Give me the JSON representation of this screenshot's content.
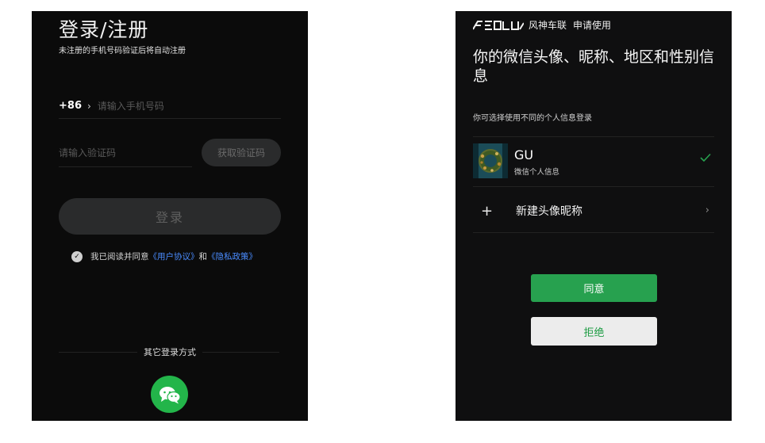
{
  "login": {
    "title": "登录/注册",
    "subtitle": "未注册的手机号码验证后将自动注册",
    "country_code": "+86",
    "chevron": "›",
    "phone_placeholder": "请输入手机号码",
    "code_placeholder": "请输入验证码",
    "get_code": "获取验证码",
    "login_button": "登录",
    "agreement": {
      "prefix": "我已阅读并同意",
      "user_agreement": "《用户协议》",
      "and": "和",
      "privacy_policy": "《隐私政策》",
      "link_color": "#4a8cff"
    },
    "other_methods": "其它登录方式",
    "wechat_icon": "wechat-icon",
    "wechat_color": "#23b54a"
  },
  "auth": {
    "brand_logo_text": "AEOLUS",
    "brand": "风神车联",
    "apply": "申请使用",
    "title": "你的微信头像、昵称、地区和性别信息",
    "hint": "你可选择使用不同的个人信息登录",
    "profile": {
      "name": "GU",
      "desc": "微信个人信息",
      "selected_icon": "check-icon"
    },
    "new_profile": {
      "plus": "+",
      "label": "新建头像昵称",
      "arrow": "›"
    },
    "agree_button": "同意",
    "reject_button": "拒绝",
    "accent_color": "#27a14f"
  }
}
